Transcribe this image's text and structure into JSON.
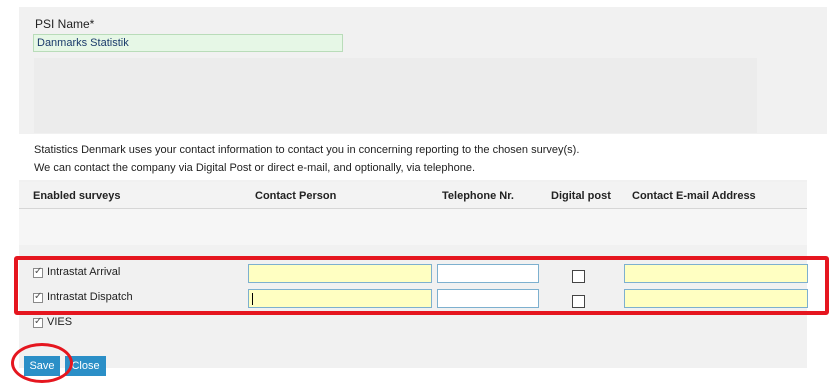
{
  "psi": {
    "label": "PSI Name*",
    "value": "Danmarks Statistik"
  },
  "info": {
    "line1": "Statistics Denmark uses your contact information to contact you in concerning reporting to the chosen survey(s).",
    "line2": "We can contact the company via Digital Post or direct e-mail, and optionally, via telephone."
  },
  "table": {
    "headers": {
      "surveys": "Enabled surveys",
      "contact": "Contact Person",
      "phone": "Telephone Nr.",
      "digital": "Digital post",
      "email": "Contact E-mail Address"
    },
    "rows": [
      {
        "label": "Intrastat Arrival",
        "enabled": true,
        "contact": "",
        "phone": "",
        "digital_post": false,
        "email": ""
      },
      {
        "label": "Intrastat Dispatch",
        "enabled": true,
        "contact": "",
        "phone": "",
        "digital_post": false,
        "email": ""
      },
      {
        "label": "VIES",
        "enabled": true
      }
    ]
  },
  "buttons": {
    "save": "Save",
    "close": "Close"
  },
  "colors": {
    "accent": "#2b8fc7",
    "highlight": "#e5161f",
    "required_field": "#ffffc2",
    "filled_field": "#e6f7e6"
  }
}
